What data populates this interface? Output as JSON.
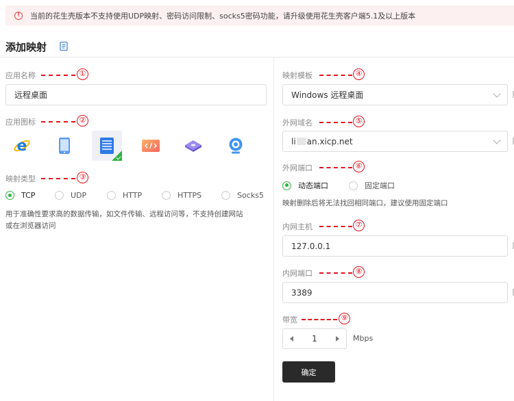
{
  "alert": {
    "text": "当前的花生壳版本不支持使用UDP映射、密码访问限制、socks5密码功能，请升级使用花生壳客户端5.1及以上版本",
    "icon": "alert-circle-icon",
    "color": "#e5484d"
  },
  "page": {
    "title": "添加映射",
    "title_icon": "document-icon"
  },
  "annotations": [
    "①",
    "②",
    "③",
    "④",
    "⑤",
    "⑥",
    "⑦",
    "⑧",
    "⑨"
  ],
  "left": {
    "app_name": {
      "label": "应用名称",
      "value": "远程桌面"
    },
    "app_icon": {
      "label": "应用图标",
      "icons": [
        {
          "name": "ie-browser-icon",
          "selected": false
        },
        {
          "name": "tablet-icon",
          "selected": false
        },
        {
          "name": "server-document-icon",
          "selected": true
        },
        {
          "name": "code-window-icon",
          "selected": false
        },
        {
          "name": "network-cube-icon",
          "selected": false
        },
        {
          "name": "webcam-icon",
          "selected": false
        }
      ]
    },
    "mapping_type": {
      "label": "映射类型",
      "options": [
        "TCP",
        "UDP",
        "HTTP",
        "HTTPS",
        "Socks5"
      ],
      "selected": "TCP",
      "description": "用于准确性要求高的数据传输，如文件传输、远程访问等，不支持创建网站或在浏览器访问"
    }
  },
  "right": {
    "template": {
      "label": "映射模板",
      "value": "Windows 远程桌面"
    },
    "domain": {
      "label": "外网域名",
      "value_prefix": "li",
      "value_suffix": "an.xicp.net"
    },
    "external_port": {
      "label": "外网端口",
      "options": [
        "动态端口",
        "固定端口"
      ],
      "selected": "动态端口",
      "note": "映射删除后将无法找回相同端口，建议使用固定端口"
    },
    "internal_host": {
      "label": "内网主机",
      "value": "127.0.0.1"
    },
    "internal_port": {
      "label": "内网端口",
      "value": "3389"
    },
    "bandwidth": {
      "label": "带宽",
      "value": "1",
      "unit": "Mbps"
    },
    "submit_label": "确定"
  },
  "colors": {
    "accent": "#2fb344",
    "annotation": "#e5121d",
    "button": "#2a2a2a"
  }
}
